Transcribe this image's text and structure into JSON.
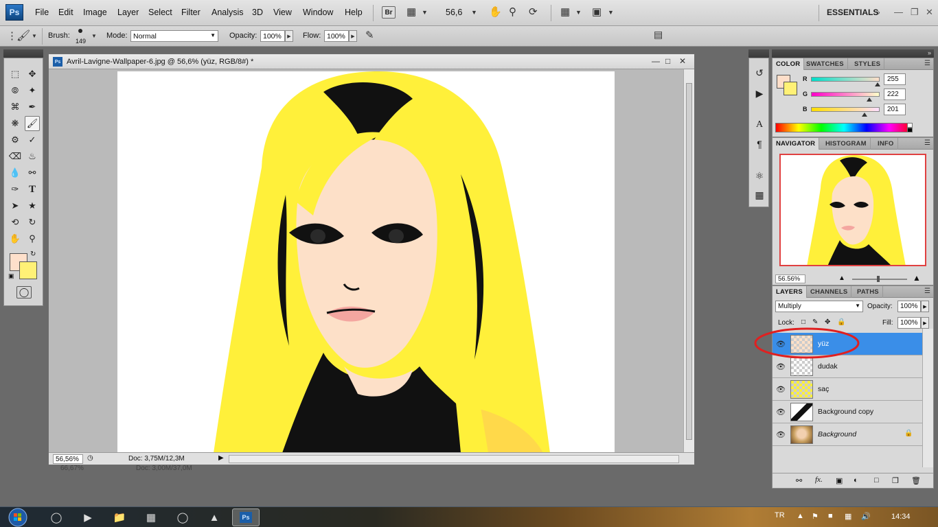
{
  "app": {
    "logo": "Ps",
    "menu": [
      "File",
      "Edit",
      "Image",
      "Layer",
      "Select",
      "Filter",
      "Analysis",
      "3D",
      "View",
      "Window",
      "Help"
    ],
    "bridge_label": "Br",
    "zoom": "56,6",
    "workspace": "ESSENTIALS"
  },
  "options": {
    "brush_label": "Brush:",
    "brush_size": "149",
    "mode_label": "Mode:",
    "mode_value": "Normal",
    "opacity_label": "Opacity:",
    "opacity_value": "100%",
    "flow_label": "Flow:",
    "flow_value": "100%"
  },
  "document": {
    "title": "Avril-Lavigne-Wallpaper-6.jpg @ 56,6% (yüz, RGB/8#) *",
    "zoom": "56,56%",
    "doc_size": "Doc: 3,75M/12,3M",
    "ghost_zoom": "66,67%",
    "ghost_doc_size": "Doc: 3,00M/37,0M"
  },
  "color_panel": {
    "tabs": [
      "COLOR",
      "SWATCHES",
      "STYLES"
    ],
    "channels": [
      {
        "label": "R",
        "value": "255",
        "level": 1.0
      },
      {
        "label": "G",
        "value": "222",
        "level": 0.87
      },
      {
        "label": "B",
        "value": "201",
        "level": 0.79
      }
    ],
    "foreground": "#fedec9",
    "background": "#fff176"
  },
  "navigator_panel": {
    "tabs": [
      "NAVIGATOR",
      "HISTOGRAM",
      "INFO"
    ],
    "zoom": "56.56%",
    "zoom_level": 0.48
  },
  "layers_panel": {
    "tabs": [
      "LAYERS",
      "CHANNELS",
      "PATHS"
    ],
    "blend_mode": "Multiply",
    "opacity_label": "Opacity:",
    "opacity_value": "100%",
    "lock_label": "Lock:",
    "fill_label": "Fill:",
    "fill_value": "100%",
    "layers": [
      {
        "name": "yüz",
        "selected": true
      },
      {
        "name": "dudak",
        "selected": false
      },
      {
        "name": "saç",
        "selected": false
      },
      {
        "name": "Background copy",
        "selected": false
      },
      {
        "name": "Background",
        "selected": false
      }
    ]
  },
  "taskbar": {
    "lang": "TR",
    "clock": "14:34"
  },
  "colors": {
    "hair_yellow": "#fff03a",
    "skin": "#fde0c8",
    "lips": "#f4a6a0",
    "selection_blue": "#3a8ee8",
    "highlight_ring": "#e02020"
  }
}
